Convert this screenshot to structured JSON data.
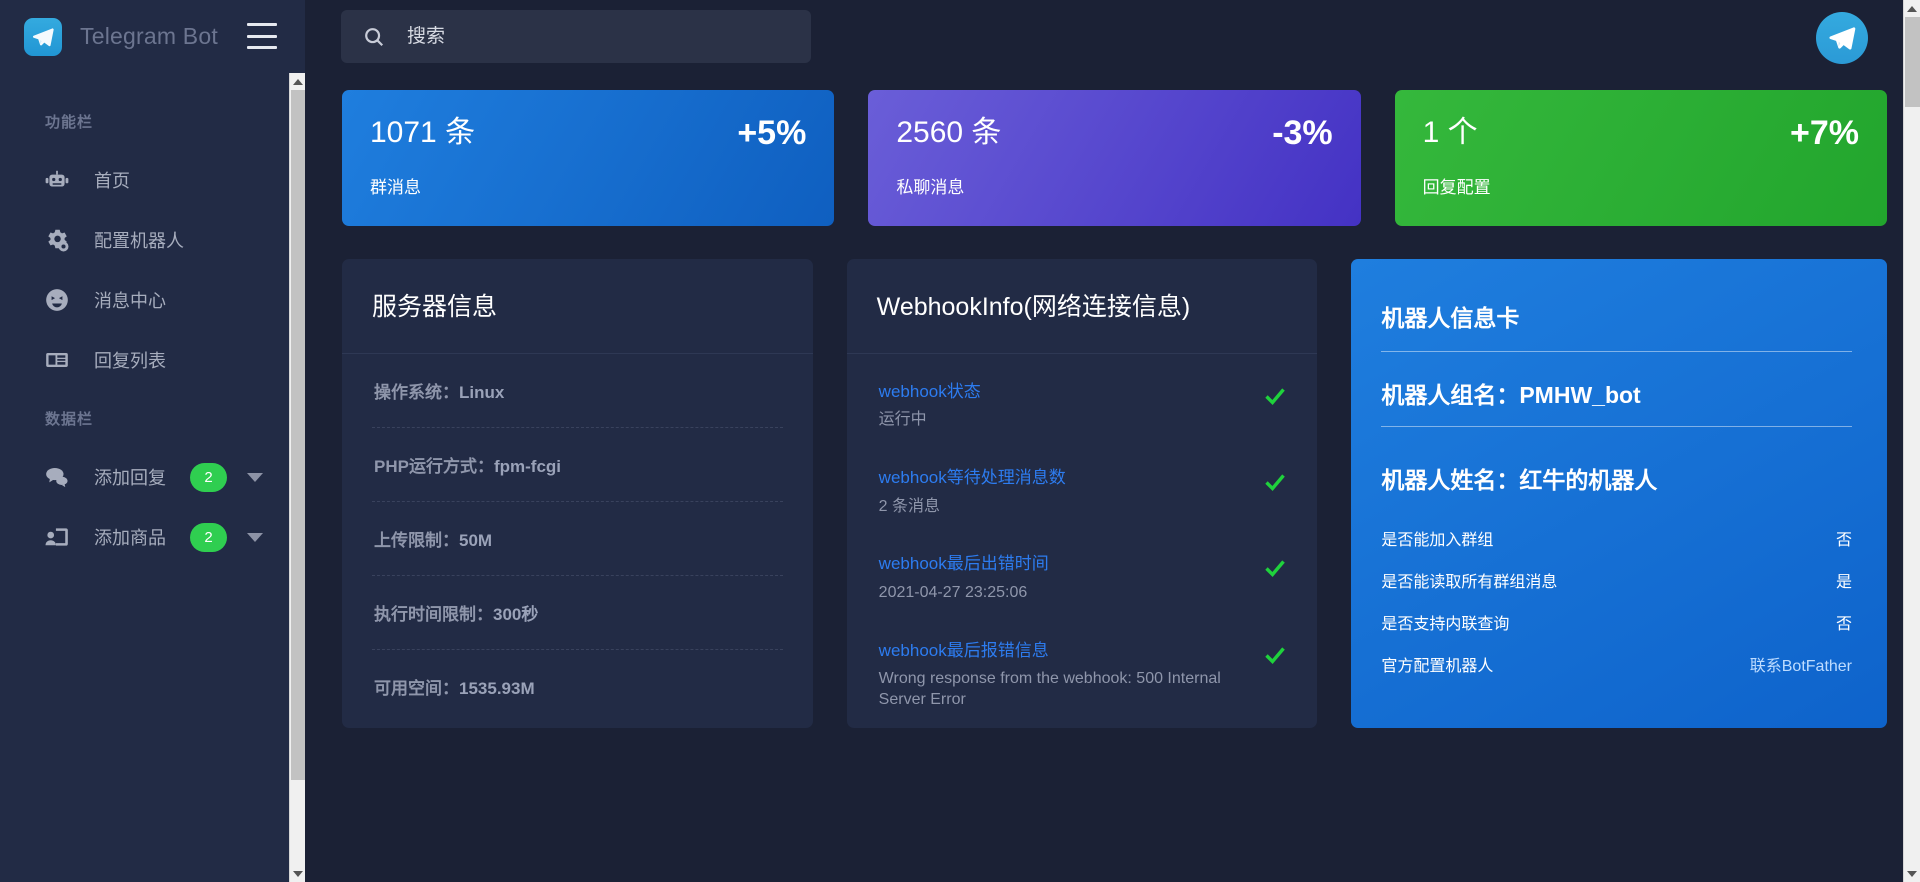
{
  "brand": {
    "title": "Telegram Bot",
    "logo_icon": "telegram-paper-plane-icon",
    "menu_icon": "hamburger-menu-icon"
  },
  "search": {
    "placeholder": "搜索",
    "value": "",
    "icon": "search-icon"
  },
  "header": {
    "avatar_icon": "telegram-avatar-icon"
  },
  "sidebar": {
    "groups": [
      {
        "title": "功能栏",
        "items": [
          {
            "label": "首页",
            "icon": "robot-icon"
          },
          {
            "label": "配置机器人",
            "icon": "gears-icon"
          },
          {
            "label": "消息中心",
            "icon": "smiley-face-icon"
          },
          {
            "label": "回复列表",
            "icon": "newspaper-icon"
          }
        ]
      },
      {
        "title": "数据栏",
        "items": [
          {
            "label": "添加回复",
            "icon": "chat-bubbles-icon",
            "badge": "2",
            "caret": "chevron-down-icon"
          },
          {
            "label": "添加商品",
            "icon": "user-screen-icon",
            "badge": "2",
            "caret": "chevron-down-icon"
          }
        ]
      }
    ]
  },
  "stats": [
    {
      "value": "1071 条",
      "delta": "+5%",
      "label": "群消息",
      "color": "#1f7ede"
    },
    {
      "value": "2560 条",
      "delta": "-3%",
      "label": "私聊消息",
      "color": "#5a4ad2"
    },
    {
      "value": "1 个",
      "delta": "+7%",
      "label": "回复配置",
      "color": "#2fae35"
    }
  ],
  "server_info": {
    "title": "服务器信息",
    "rows": [
      {
        "key": "操作系统：",
        "value": "Linux"
      },
      {
        "key": "PHP运行方式：",
        "value": "fpm-fcgi"
      },
      {
        "key": "上传限制：",
        "value": "50M"
      },
      {
        "key": "执行时间限制：",
        "value": "300秒"
      },
      {
        "key": "可用空间：",
        "value": "1535.93M"
      }
    ]
  },
  "webhook_info": {
    "title": "WebhookInfo(网络连接信息)",
    "rows": [
      {
        "key": "webhook状态",
        "value": "运行中",
        "status_icon": "check-icon"
      },
      {
        "key": "webhook等待处理消息数",
        "value": "2 条消息",
        "status_icon": "check-icon"
      },
      {
        "key": "webhook最后出错时间",
        "value": "2021-04-27 23:25:06",
        "status_icon": "check-icon"
      },
      {
        "key": "webhook最后报错信息",
        "value": "Wrong response from the webhook: 500 Internal Server Error",
        "status_icon": "check-icon"
      }
    ]
  },
  "bot_card": {
    "title": "机器人信息卡",
    "group_name": "机器人组名：PMHW_bot",
    "bot_name": "机器人姓名：红牛的机器人",
    "rows": [
      {
        "label": "是否能加入群组",
        "value": "否",
        "is_link": false
      },
      {
        "label": "是否能读取所有群组消息",
        "value": "是",
        "is_link": false
      },
      {
        "label": "是否支持内联查询",
        "value": "否",
        "is_link": false
      },
      {
        "label": "官方配置机器人",
        "value": "联系BotFather",
        "is_link": true
      }
    ]
  }
}
